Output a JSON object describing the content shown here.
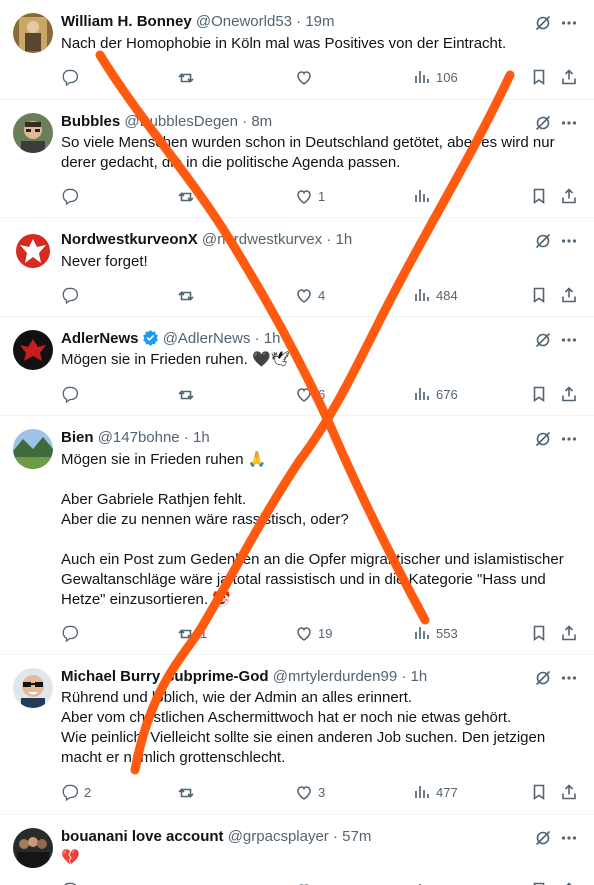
{
  "colors": {
    "text": "#0f1419",
    "muted": "#536471",
    "divider": "#eff3f4",
    "verified": "#1d9bf0",
    "overlay_stroke": "#ff5a10"
  },
  "tweets": [
    {
      "avatar_icon": "painting-avatar",
      "name": "William H. Bonney",
      "handle": "@Oneworld53",
      "time": "19m",
      "verified": false,
      "lines": [
        "Nach der Homophobie in Köln mal was Positives von der Eintracht."
      ],
      "counts": {
        "reply": "",
        "retweet": "",
        "like": "",
        "views": "106"
      }
    },
    {
      "avatar_icon": "portrait-avatar",
      "name": "Bubbles",
      "handle": "@BubblesDegen",
      "time": "8m",
      "verified": false,
      "lines": [
        "So viele Menschen wurden schon in Deutschland getötet, aber es wird nur",
        "derer gedacht, die in die politische Agenda passen."
      ],
      "counts": {
        "reply": "",
        "retweet": "",
        "like": "1",
        "views": ""
      }
    },
    {
      "avatar_icon": "eagle-crest-avatar",
      "name": "NordwestkurveonX",
      "handle": "@nordwestkurvex",
      "time": "1h",
      "verified": false,
      "lines": [
        "Never forget!"
      ],
      "counts": {
        "reply": "",
        "retweet": "",
        "like": "4",
        "views": "484"
      }
    },
    {
      "avatar_icon": "eagle-logo-avatar",
      "name": "AdlerNews",
      "handle": "@AdlerNews",
      "time": "1h",
      "verified": true,
      "lines": [
        "Mögen sie in Frieden ruhen. 🖤🕊"
      ],
      "counts": {
        "reply": "",
        "retweet": "",
        "like": "6",
        "views": "676"
      }
    },
    {
      "avatar_icon": "landscape-avatar",
      "name": "Bien",
      "handle": "@147bohne",
      "time": "1h",
      "verified": false,
      "lines": [
        "Mögen sie in Frieden ruhen 🙏",
        "",
        "Aber Gabriele Rathjen fehlt.",
        "Aber die zu nennen wäre rassistisch, oder?",
        "",
        "Auch ein Post zum Gedenken an die Opfer migrantischer und islamistischer",
        "Gewaltanschläge wäre ja total rassistisch und in die Kategorie \"Hass und",
        "Hetze\" einzusortieren. 🤡"
      ],
      "counts": {
        "reply": "",
        "retweet": "1",
        "like": "19",
        "views": "553"
      }
    },
    {
      "avatar_icon": "sunglasses-avatar",
      "name": "Michael Burry Subprime-God",
      "handle": "@mrtylerdurden99",
      "time": "1h",
      "verified": false,
      "lines": [
        "Rührend und löblich, wie der Admin an alles erinnert.",
        "Aber vom christlichen Aschermittwoch hat er noch nie etwas gehört.",
        "Wie peinlich. Vielleicht sollte sie einen anderen Job suchen. Den jetzigen",
        "macht er nämlich grottenschlecht."
      ],
      "counts": {
        "reply": "2",
        "retweet": "",
        "like": "3",
        "views": "477"
      }
    },
    {
      "avatar_icon": "group-photo-avatar",
      "name": "bouanani love account",
      "handle": "@grpacsplayer",
      "time": "57m",
      "verified": false,
      "lines": [
        "💔"
      ],
      "counts": {
        "reply": "",
        "retweet": "",
        "like": "",
        "views": ""
      }
    }
  ]
}
